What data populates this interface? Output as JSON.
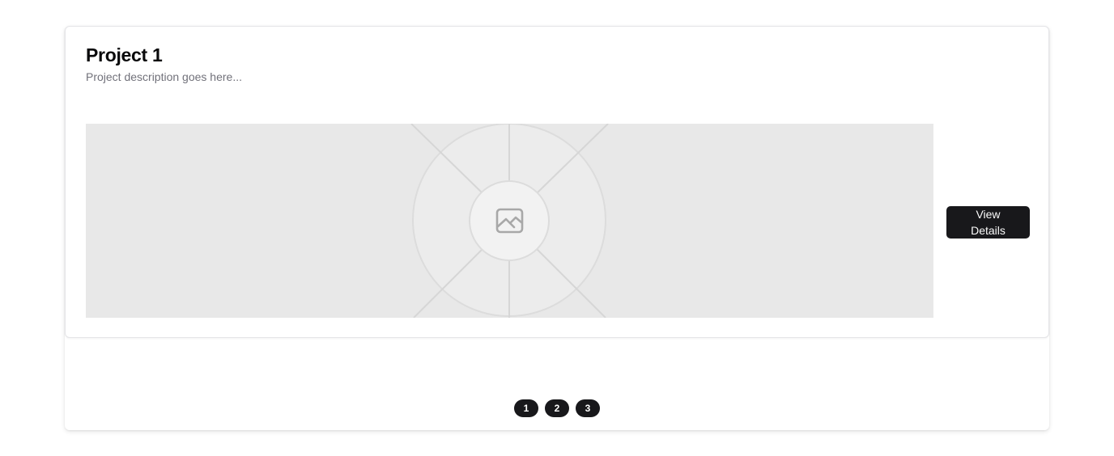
{
  "project": {
    "title": "Project 1",
    "description": "Project description goes here...",
    "image_icon": "image-placeholder-icon",
    "view_button_label": "View Details"
  },
  "pagination": {
    "pages": [
      "1",
      "2",
      "3"
    ]
  },
  "colors": {
    "primary": "#18181b",
    "muted_text": "#71717a",
    "placeholder_bg": "#e8e8e8"
  }
}
